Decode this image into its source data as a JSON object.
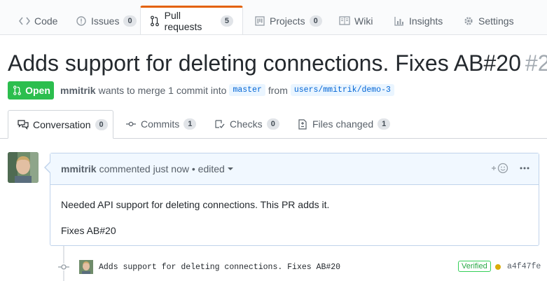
{
  "repo_nav": {
    "tabs": [
      {
        "label": "Code",
        "icon": "code-icon"
      },
      {
        "label": "Issues",
        "icon": "issue-icon",
        "count": "0"
      },
      {
        "label": "Pull requests",
        "icon": "git-pull-request-icon",
        "count": "5",
        "selected": true
      },
      {
        "label": "Projects",
        "icon": "project-icon",
        "count": "0"
      },
      {
        "label": "Wiki",
        "icon": "book-icon"
      },
      {
        "label": "Insights",
        "icon": "graph-icon"
      },
      {
        "label": "Settings",
        "icon": "gear-icon"
      }
    ]
  },
  "pr": {
    "title": "Adds support for deleting connections. Fixes AB#20",
    "number": "#2",
    "state": "Open",
    "author": "mmitrik",
    "merge_text": "wants to merge 1 commit into",
    "base": "master",
    "from_text": "from",
    "head": "users/mmitrik/demo-3"
  },
  "pr_tabs": [
    {
      "label": "Conversation",
      "count": "0",
      "icon": "comment-discussion-icon",
      "selected": true
    },
    {
      "label": "Commits",
      "count": "1",
      "icon": "git-commit-icon"
    },
    {
      "label": "Checks",
      "count": "0",
      "icon": "checklist-icon"
    },
    {
      "label": "Files changed",
      "count": "1",
      "icon": "file-diff-icon"
    }
  ],
  "comment": {
    "author": "mmitrik",
    "action": "commented",
    "time": "just now",
    "edited": "• edited",
    "body_line1": "Needed API support for deleting connections. This PR adds it.",
    "body_line2": "Fixes AB#20"
  },
  "commit": {
    "message": "Adds support for deleting connections. Fixes AB#20",
    "verified": "Verified",
    "sha": "a4f47fe"
  },
  "colors": {
    "open_green": "#2cbe4e",
    "selected_tab_accent": "#e36209",
    "link_blue": "#0366d6",
    "status_pending": "#dbab09"
  }
}
